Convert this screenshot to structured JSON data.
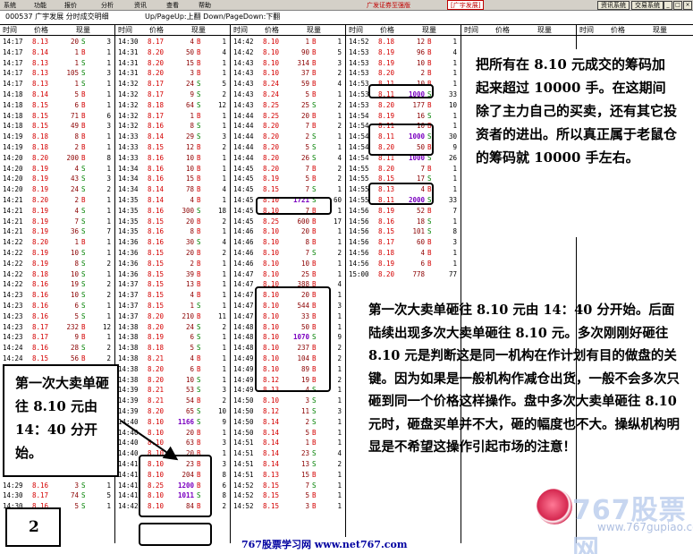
{
  "menubar": {
    "items": [
      "系统",
      "功能",
      "报价",
      "分析",
      "资讯",
      "查看",
      "帮助"
    ],
    "brand": "广发证券至强版",
    "brand_tag": "[广宇发展]",
    "btn_news": "资讯系统",
    "btn_sys": "交易系统",
    "win_min": "_",
    "win_max": "□",
    "win_close": "×"
  },
  "titlebar": {
    "title": "000537 广宇发展 分时成交明细",
    "hint": "Up/PageUp:上翻 Down/PageDown:下翻"
  },
  "headers": {
    "time": "时间",
    "price": "价格",
    "vol": "现量"
  },
  "columns": [
    [
      [
        "14:17",
        "8.13",
        "20",
        "S",
        "3"
      ],
      [
        "14:17",
        "8.14",
        "1",
        "B",
        "1"
      ],
      [
        "14:17",
        "8.13",
        "1",
        "S",
        "1"
      ],
      [
        "14:17",
        "8.13",
        "105",
        "S",
        "3"
      ],
      [
        "14:17",
        "8.13",
        "1",
        "S",
        "1"
      ],
      [
        "14:18",
        "8.14",
        "5",
        "B",
        "1"
      ],
      [
        "14:18",
        "8.15",
        "6",
        "B",
        "1"
      ],
      [
        "14:18",
        "8.15",
        "71",
        "B",
        "6"
      ],
      [
        "14:18",
        "8.15",
        "49",
        "B",
        "3"
      ],
      [
        "14:19",
        "8.18",
        "8",
        "B",
        "1"
      ],
      [
        "14:19",
        "8.18",
        "2",
        "B",
        "1"
      ],
      [
        "14:20",
        "8.20",
        "200",
        "B",
        "8"
      ],
      [
        "14:20",
        "8.19",
        "4",
        "S",
        "1"
      ],
      [
        "14:20",
        "8.19",
        "43",
        "S",
        "3"
      ],
      [
        "14:20",
        "8.19",
        "24",
        "S",
        "2"
      ],
      [
        "14:21",
        "8.20",
        "2",
        "B",
        "1"
      ],
      [
        "14:21",
        "8.19",
        "4",
        "S",
        "1"
      ],
      [
        "14:21",
        "8.19",
        "7",
        "S",
        "1"
      ],
      [
        "14:21",
        "8.19",
        "36",
        "S",
        "7"
      ],
      [
        "14:22",
        "8.20",
        "1",
        "B",
        "1"
      ],
      [
        "14:22",
        "8.19",
        "10",
        "S",
        "1"
      ],
      [
        "14:22",
        "8.19",
        "8",
        "S",
        "2"
      ],
      [
        "14:22",
        "8.18",
        "10",
        "S",
        "1"
      ],
      [
        "14:22",
        "8.16",
        "19",
        "S",
        "2"
      ],
      [
        "14:23",
        "8.16",
        "10",
        "S",
        "2"
      ],
      [
        "14:23",
        "8.16",
        "6",
        "S",
        "1"
      ],
      [
        "14:23",
        "8.16",
        "5",
        "S",
        "1"
      ],
      [
        "14:23",
        "8.17",
        "232",
        "B",
        "12"
      ],
      [
        "14:23",
        "8.17",
        "9",
        "B",
        "1"
      ],
      [
        "14:24",
        "8.16",
        "28",
        "S",
        "2"
      ],
      [
        "14:24",
        "8.15",
        "56",
        "B",
        "2"
      ],
      [
        "14:25",
        "8.15",
        "1",
        "S",
        "1"
      ],
      [
        "14:25",
        "8.16",
        "1",
        "B",
        "1"
      ],
      [
        "14:26",
        "8.16",
        "5",
        "B",
        "1"
      ],
      [
        "14:26",
        "8.16",
        "6",
        "B",
        "1"
      ],
      [
        "14:27",
        "8.17",
        "14",
        "B",
        "1"
      ],
      [
        "14:27",
        "8.17",
        "5",
        "B",
        "1"
      ],
      [
        "14:27",
        "8.17",
        "3",
        "B",
        "1"
      ],
      [
        "14:27",
        "8.16",
        "1",
        "S",
        "1"
      ],
      [
        "14:28",
        "8.16",
        "8",
        "S",
        "1"
      ],
      [
        "14:28",
        "8.17",
        "15",
        "S",
        "3"
      ],
      [
        "14:29",
        "8.17",
        "1",
        "B",
        "1"
      ],
      [
        "14:29",
        "8.16",
        "3",
        "S",
        "1"
      ],
      [
        "14:30",
        "8.17",
        "74",
        "S",
        "5"
      ],
      [
        "14:30",
        "8.16",
        "5",
        "S",
        "1"
      ]
    ],
    [
      [
        "14:30",
        "8.17",
        "4",
        "B",
        "1"
      ],
      [
        "14:31",
        "8.20",
        "50",
        "B",
        "4"
      ],
      [
        "14:31",
        "8.20",
        "15",
        "B",
        "1"
      ],
      [
        "14:31",
        "8.20",
        "3",
        "B",
        "1"
      ],
      [
        "14:32",
        "8.17",
        "24",
        "S",
        "5"
      ],
      [
        "14:32",
        "8.17",
        "9",
        "S",
        "2"
      ],
      [
        "14:32",
        "8.18",
        "64",
        "S",
        "12"
      ],
      [
        "14:32",
        "8.17",
        "1",
        "B",
        "1"
      ],
      [
        "14:32",
        "8.16",
        "8",
        "S",
        "1"
      ],
      [
        "14:33",
        "8.14",
        "29",
        "S",
        "3"
      ],
      [
        "14:33",
        "8.15",
        "12",
        "B",
        "2"
      ],
      [
        "14:33",
        "8.16",
        "10",
        "B",
        "1"
      ],
      [
        "14:34",
        "8.16",
        "10",
        "B",
        "1"
      ],
      [
        "14:34",
        "8.16",
        "15",
        "B",
        "1"
      ],
      [
        "14:34",
        "8.14",
        "78",
        "B",
        "4"
      ],
      [
        "14:35",
        "8.14",
        "4",
        "B",
        "1"
      ],
      [
        "14:35",
        "8.16",
        "300",
        "S",
        "18"
      ],
      [
        "14:35",
        "8.15",
        "20",
        "B",
        "2"
      ],
      [
        "14:35",
        "8.16",
        "8",
        "B",
        "1"
      ],
      [
        "14:36",
        "8.16",
        "30",
        "S",
        "4"
      ],
      [
        "14:36",
        "8.15",
        "20",
        "B",
        "2"
      ],
      [
        "14:36",
        "8.15",
        "2",
        "B",
        "1"
      ],
      [
        "14:36",
        "8.15",
        "39",
        "B",
        "1"
      ],
      [
        "14:37",
        "8.15",
        "13",
        "B",
        "1"
      ],
      [
        "14:37",
        "8.15",
        "4",
        "B",
        "1"
      ],
      [
        "14:37",
        "8.15",
        "1",
        "S",
        "1"
      ],
      [
        "14:37",
        "8.20",
        "210",
        "B",
        "11"
      ],
      [
        "14:38",
        "8.20",
        "24",
        "S",
        "2"
      ],
      [
        "14:38",
        "8.19",
        "6",
        "S",
        "1"
      ],
      [
        "14:38",
        "8.18",
        "5",
        "S",
        "1"
      ],
      [
        "14:38",
        "8.21",
        "4",
        "B",
        "1"
      ],
      [
        "14:38",
        "8.20",
        "6",
        "B",
        "1"
      ],
      [
        "14:38",
        "8.20",
        "10",
        "S",
        "1"
      ],
      [
        "14:39",
        "8.21",
        "53",
        "S",
        "3"
      ],
      [
        "14:39",
        "8.21",
        "54",
        "B",
        "2"
      ],
      [
        "14:39",
        "8.20",
        "65",
        "S",
        "10"
      ],
      [
        "14:40",
        "8.10",
        "1166",
        "S",
        "9"
      ],
      [
        "14:40",
        "8.10",
        "20",
        "B",
        "1"
      ],
      [
        "14:40",
        "8.10",
        "63",
        "B",
        "3"
      ],
      [
        "14:40",
        "8.10",
        "20",
        "B",
        "1"
      ],
      [
        "14:41",
        "8.10",
        "23",
        "B",
        "3"
      ],
      [
        "14:41",
        "8.10",
        "204",
        "B",
        "8"
      ],
      [
        "14:41",
        "8.25",
        "1200",
        "B",
        "6"
      ],
      [
        "14:41",
        "8.10",
        "1011",
        "S",
        "8"
      ],
      [
        "14:42",
        "8.10",
        "84",
        "B",
        "2"
      ]
    ],
    [
      [
        "14:42",
        "8.10",
        "1",
        "B",
        "1"
      ],
      [
        "14:42",
        "8.10",
        "90",
        "B",
        "5"
      ],
      [
        "14:43",
        "8.10",
        "314",
        "B",
        "3"
      ],
      [
        "14:43",
        "8.10",
        "37",
        "B",
        "2"
      ],
      [
        "14:43",
        "8.24",
        "59",
        "B",
        "4"
      ],
      [
        "14:43",
        "8.24",
        "5",
        "B",
        "1"
      ],
      [
        "14:43",
        "8.25",
        "25",
        "S",
        "2"
      ],
      [
        "14:44",
        "8.25",
        "20",
        "B",
        "1"
      ],
      [
        "14:44",
        "8.20",
        "7",
        "B",
        "2"
      ],
      [
        "14:44",
        "8.20",
        "2",
        "S",
        "1"
      ],
      [
        "14:44",
        "8.20",
        "5",
        "S",
        "1"
      ],
      [
        "14:44",
        "8.20",
        "26",
        "S",
        "4"
      ],
      [
        "14:45",
        "8.20",
        "7",
        "B",
        "2"
      ],
      [
        "14:45",
        "8.19",
        "5",
        "B",
        "2"
      ],
      [
        "14:45",
        "8.15",
        "7",
        "S",
        "1"
      ],
      [
        "14:45",
        "8.10",
        "1721",
        "S",
        "60"
      ],
      [
        "14:45",
        "8.10",
        "7",
        "B",
        "1"
      ],
      [
        "14:45",
        "8.25",
        "600",
        "B",
        "17"
      ],
      [
        "14:46",
        "8.10",
        "20",
        "B",
        "1"
      ],
      [
        "14:46",
        "8.10",
        "8",
        "B",
        "1"
      ],
      [
        "14:46",
        "8.10",
        "7",
        "S",
        "2"
      ],
      [
        "14:46",
        "8.10",
        "10",
        "B",
        "1"
      ],
      [
        "14:47",
        "8.10",
        "25",
        "B",
        "1"
      ],
      [
        "14:47",
        "8.10",
        "388",
        "B",
        "4"
      ],
      [
        "14:47",
        "8.10",
        "20",
        "B",
        "1"
      ],
      [
        "14:47",
        "8.10",
        "544",
        "B",
        "3"
      ],
      [
        "14:47",
        "8.10",
        "33",
        "B",
        "1"
      ],
      [
        "14:48",
        "8.10",
        "50",
        "B",
        "1"
      ],
      [
        "14:48",
        "8.10",
        "1070",
        "S",
        "9"
      ],
      [
        "14:48",
        "8.10",
        "237",
        "B",
        "2"
      ],
      [
        "14:49",
        "8.10",
        "104",
        "B",
        "2"
      ],
      [
        "14:49",
        "8.10",
        "89",
        "B",
        "1"
      ],
      [
        "14:49",
        "8.12",
        "19",
        "B",
        "2"
      ],
      [
        "14:49",
        "8.13",
        "4",
        "S",
        "1"
      ],
      [
        "14:50",
        "8.10",
        "3",
        "S",
        "1"
      ],
      [
        "14:50",
        "8.12",
        "11",
        "S",
        "3"
      ],
      [
        "14:50",
        "8.14",
        "2",
        "S",
        "1"
      ],
      [
        "14:50",
        "8.14",
        "5",
        "B",
        "1"
      ],
      [
        "14:51",
        "8.14",
        "1",
        "B",
        "1"
      ],
      [
        "14:51",
        "8.14",
        "23",
        "S",
        "4"
      ],
      [
        "14:51",
        "8.14",
        "13",
        "S",
        "2"
      ],
      [
        "14:51",
        "8.13",
        "15",
        "B",
        "1"
      ],
      [
        "14:52",
        "8.15",
        "7",
        "S",
        "1"
      ],
      [
        "14:52",
        "8.15",
        "5",
        "B",
        "1"
      ],
      [
        "14:52",
        "8.15",
        "3",
        "B",
        "1"
      ]
    ],
    [
      [
        "14:52",
        "8.18",
        "12",
        "B",
        "1"
      ],
      [
        "14:53",
        "8.19",
        "96",
        "B",
        "4"
      ],
      [
        "14:53",
        "8.19",
        "10",
        "B",
        "1"
      ],
      [
        "14:53",
        "8.20",
        "2",
        "B",
        "1"
      ],
      [
        "14:53",
        "8.11",
        "10",
        "B",
        "1"
      ],
      [
        "14:53",
        "8.11",
        "1000",
        "S",
        "33"
      ],
      [
        "14:53",
        "8.20",
        "177",
        "B",
        "10"
      ],
      [
        "14:54",
        "8.19",
        "16",
        "S",
        "1"
      ],
      [
        "14:54",
        "8.11",
        "10",
        "B",
        "1"
      ],
      [
        "14:54",
        "8.11",
        "1000",
        "S",
        "30"
      ],
      [
        "14:54",
        "8.20",
        "50",
        "B",
        "9"
      ],
      [
        "14:54",
        "8.11",
        "1000",
        "S",
        "26"
      ],
      [
        "14:55",
        "8.20",
        "7",
        "B",
        "1"
      ],
      [
        "14:55",
        "8.15",
        "17",
        "S",
        "1"
      ],
      [
        "14:55",
        "8.13",
        "4",
        "B",
        "1"
      ],
      [
        "14:55",
        "8.11",
        "2000",
        "S",
        "33"
      ],
      [
        "14:56",
        "8.19",
        "52",
        "B",
        "7"
      ],
      [
        "14:56",
        "8.16",
        "18",
        "S",
        "1"
      ],
      [
        "14:56",
        "8.15",
        "101",
        "S",
        "8"
      ],
      [
        "14:56",
        "8.17",
        "60",
        "B",
        "3"
      ],
      [
        "14:56",
        "8.18",
        "4",
        "B",
        "1"
      ],
      [
        "14:56",
        "8.19",
        "6",
        "B",
        "1"
      ],
      [
        "15:00",
        "8.20",
        "778",
        "",
        "77"
      ]
    ]
  ],
  "notes": {
    "note1": "把所有在 8.10 元成交的筹码加起来超过 10000 手。在这期间除了主力自己的买卖，还有其它投资者的进出。所以真正属于老鼠仓的筹码就 10000 手左右。",
    "note2": "第一次大卖单砸往 8.10 元由 14：40 分开始。后面陆续出现多次大卖单砸往 8.10 元。多次刚刚好砸往 8.10 元是判断这是同一机构在作计划有目的做盘的关键。因为如果是一般机构作减仓出货，一般不会多次只砸到同一个价格这样操作。盘中多次大卖单砸往 8.10 元时，砸盘买单并不大，砸的幅度也不大。操纵机构明显是不希望这操作引起市场的注意！",
    "note3": "第一次大卖单砸往 8.10 元由 14：40 分开始。",
    "badge": "2",
    "footer": "767股票学习网 www.net767.com",
    "watermark": "767股票网",
    "watermark_url": "www.767gupiao.com"
  },
  "colors": {
    "price": "#d40000",
    "buy": "#d40000",
    "sell": "#008000",
    "highlight": "#7a00c0"
  }
}
